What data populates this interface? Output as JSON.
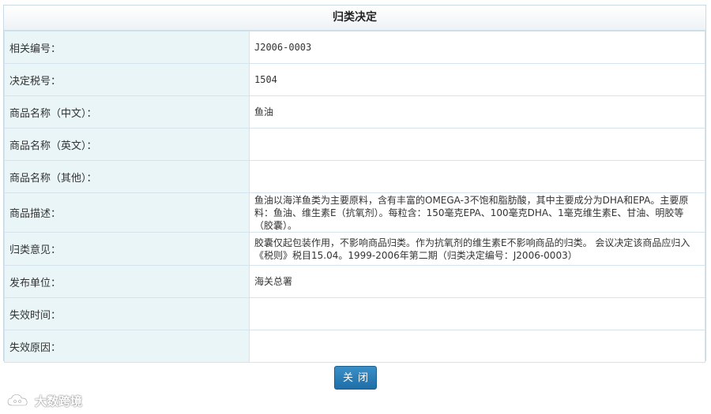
{
  "panel": {
    "title": "归类决定"
  },
  "rows": [
    {
      "label": "相关编号：",
      "value": "J2006-0003"
    },
    {
      "label": "决定税号：",
      "value": "1504"
    },
    {
      "label": "商品名称（中文）：",
      "value": "鱼油"
    },
    {
      "label": "商品名称（英文）：",
      "value": ""
    },
    {
      "label": "商品名称（其他）：",
      "value": ""
    },
    {
      "label": "商品描述：",
      "value": "鱼油以海洋鱼类为主要原料，含有丰富的OMEGA-3不饱和脂肪酸，其中主要成分为DHA和EPA。主要原料：鱼油、维生素E（抗氧剂）。每粒含：150毫克EPA、100毫克DHA、1毫克维生素E、甘油、明胶等（胶囊）。"
    },
    {
      "label": "归类意见：",
      "value": "胶囊仅起包装作用，不影响商品归类。作为抗氧剂的维生素E不影响商品的归类。 会议决定该商品应归入《税则》税目15.04。1999-2006年第二期（归类决定编号：J2006-0003）"
    },
    {
      "label": "发布单位：",
      "value": "海关总署"
    },
    {
      "label": "失效时间：",
      "value": ""
    },
    {
      "label": "失效原因：",
      "value": ""
    }
  ],
  "buttons": {
    "close_label": "关闭"
  },
  "watermark": {
    "text": "大数跨境",
    "icon": "cloud-logo-icon"
  },
  "colors": {
    "label_bg": "#e9f5f7",
    "border": "#d4e3ec",
    "button_bg": "#2a7db8"
  }
}
